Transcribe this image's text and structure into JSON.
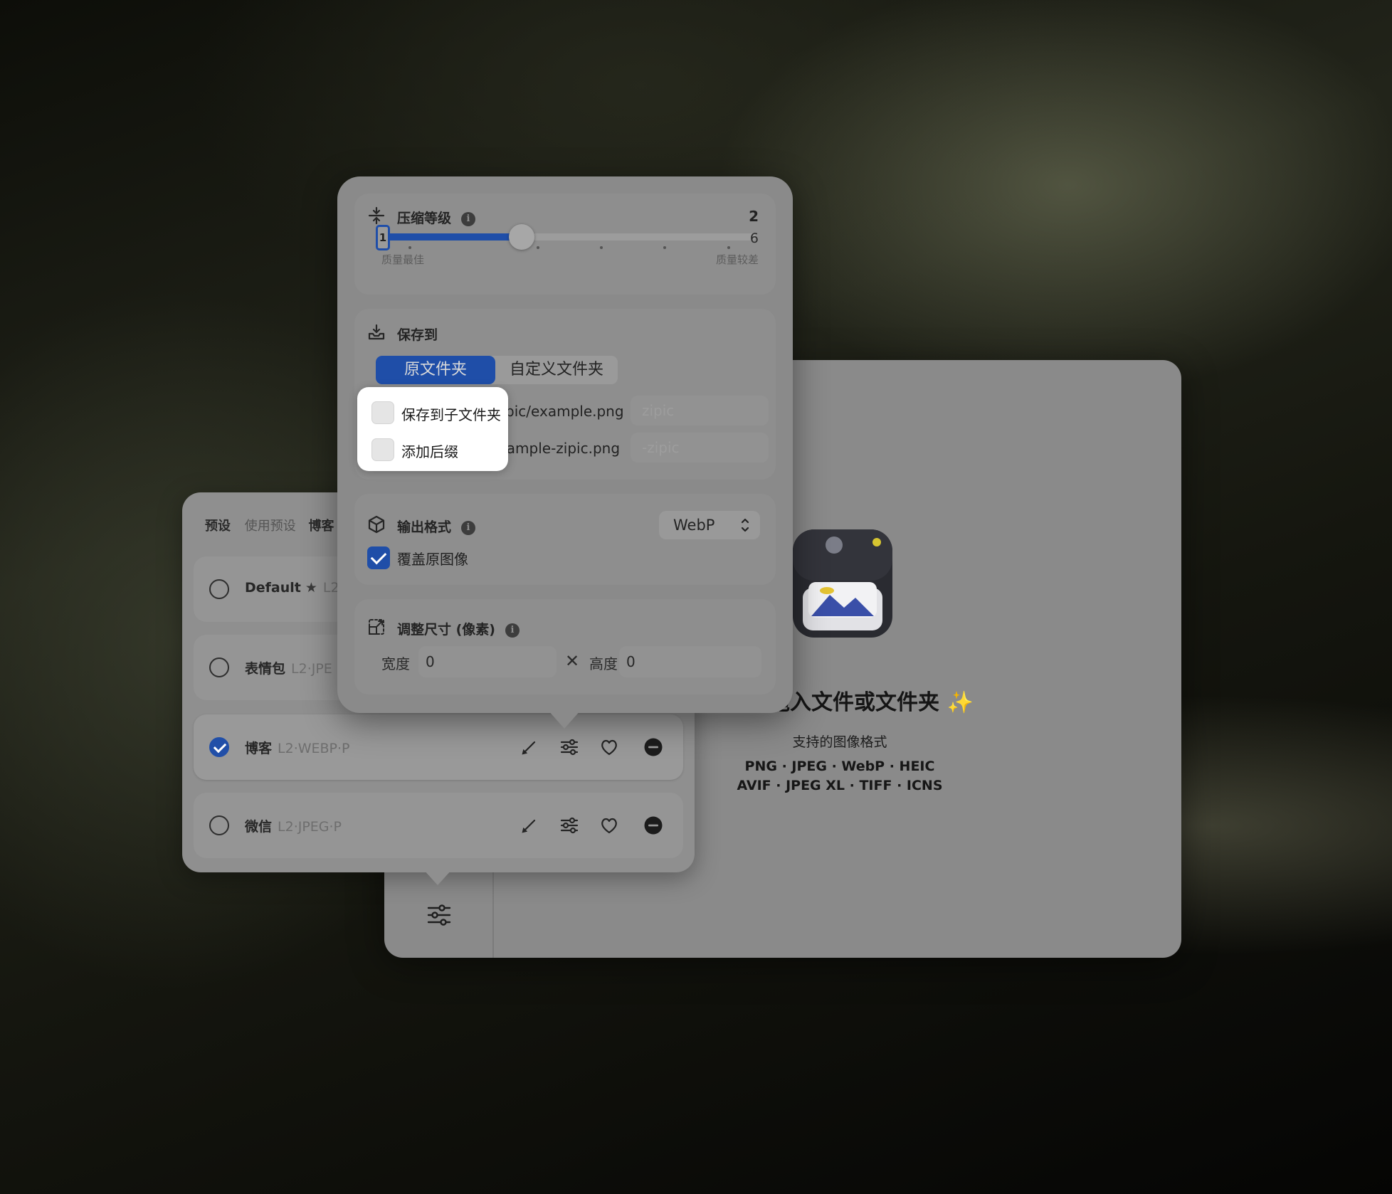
{
  "main_window": {
    "drop_title": "拖入文件或文件夹 ✨",
    "supported_label": "支持的图像格式",
    "formats_line1": "PNG · JPEG · WebP · HEIC",
    "formats_line2": "AVIF · JPEG XL · TIFF · ICNS"
  },
  "presets": {
    "title": "预设",
    "subtitle": "使用预设",
    "current": "博客",
    "items": [
      {
        "name": "Default",
        "tags": "L2",
        "favorite": true,
        "selected": false
      },
      {
        "name": "表情包",
        "tags": "L2·JPE",
        "selected": false
      },
      {
        "name": "博客",
        "tags": "L2·WEBP·P",
        "selected": true
      },
      {
        "name": "微信",
        "tags": "L2·JPEG·P",
        "selected": false
      }
    ],
    "star_glyph": "★"
  },
  "settings": {
    "compression": {
      "title": "压缩等级",
      "info": "i",
      "value": "2",
      "level": 2,
      "min": "1",
      "max": "6",
      "min_caption": "质量最佳",
      "max_caption": "质量较差"
    },
    "save_to": {
      "title": "保存到",
      "option_original": "原文件夹",
      "option_custom": "自定义文件夹",
      "selected": "原文件夹",
      "subfolder_label": "保存到子文件夹",
      "subfolder_example": "zipic/example.png",
      "subfolder_placeholder": "zipic",
      "subfolder_checked": false,
      "suffix_label": "添加后缀",
      "suffix_example": "example-zipic.png",
      "suffix_placeholder": "-zipic",
      "suffix_checked": false
    },
    "output_format": {
      "title": "输出格式",
      "info": "i",
      "selected": "WebP",
      "overwrite_label": "覆盖原图像",
      "overwrite_checked": true
    },
    "resize": {
      "title": "调整尺寸 (像素)",
      "info": "i",
      "width_label": "宽度",
      "width_value": "0",
      "height_label": "高度",
      "height_value": "0",
      "times_glyph": "✕"
    }
  },
  "colors": {
    "accent": "#1f4ea8"
  }
}
